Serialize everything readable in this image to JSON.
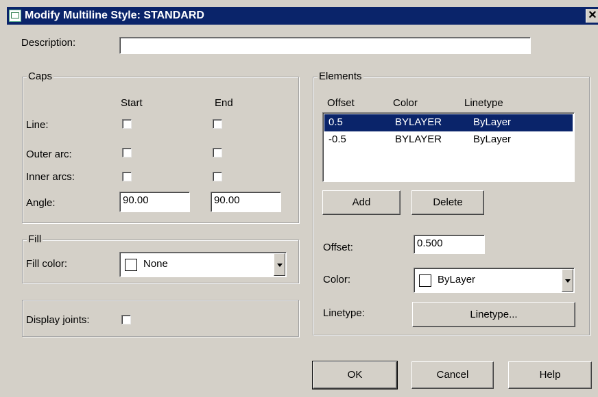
{
  "window": {
    "title": "Modify Multiline Style: STANDARD",
    "close_label": "✕"
  },
  "description": {
    "label": "Description:",
    "value": ""
  },
  "caps": {
    "legend": "Caps",
    "start_header": "Start",
    "end_header": "End",
    "rows": [
      {
        "label": "Line:",
        "start_checked": false,
        "end_checked": false
      },
      {
        "label": "Outer arc:",
        "start_checked": false,
        "end_checked": false
      },
      {
        "label": "Inner arcs:",
        "start_checked": false,
        "end_checked": false
      }
    ],
    "angle_label": "Angle:",
    "angle_start": "90.00",
    "angle_end": "90.00"
  },
  "fill": {
    "legend": "Fill",
    "label": "Fill color:",
    "value": "None",
    "swatch_color": "#ffffff"
  },
  "display_joints": {
    "label": "Display joints:",
    "checked": false
  },
  "elements": {
    "legend": "Elements",
    "columns": [
      "Offset",
      "Color",
      "Linetype"
    ],
    "rows": [
      {
        "offset": "0.5",
        "color": "BYLAYER",
        "linetype": "ByLayer",
        "selected": true
      },
      {
        "offset": "-0.5",
        "color": "BYLAYER",
        "linetype": "ByLayer",
        "selected": false
      }
    ],
    "add_label": "Add",
    "delete_label": "Delete",
    "offset_label": "Offset:",
    "offset_value": "0.500",
    "color_label": "Color:",
    "color_value": "ByLayer",
    "linetype_label": "Linetype:",
    "linetype_button": "Linetype..."
  },
  "buttons": {
    "ok": "OK",
    "cancel": "Cancel",
    "help": "Help"
  },
  "colors": {
    "titlebar": "#0a246a",
    "dialog_bg": "#d4d0c8",
    "selection": "#0a246a"
  }
}
